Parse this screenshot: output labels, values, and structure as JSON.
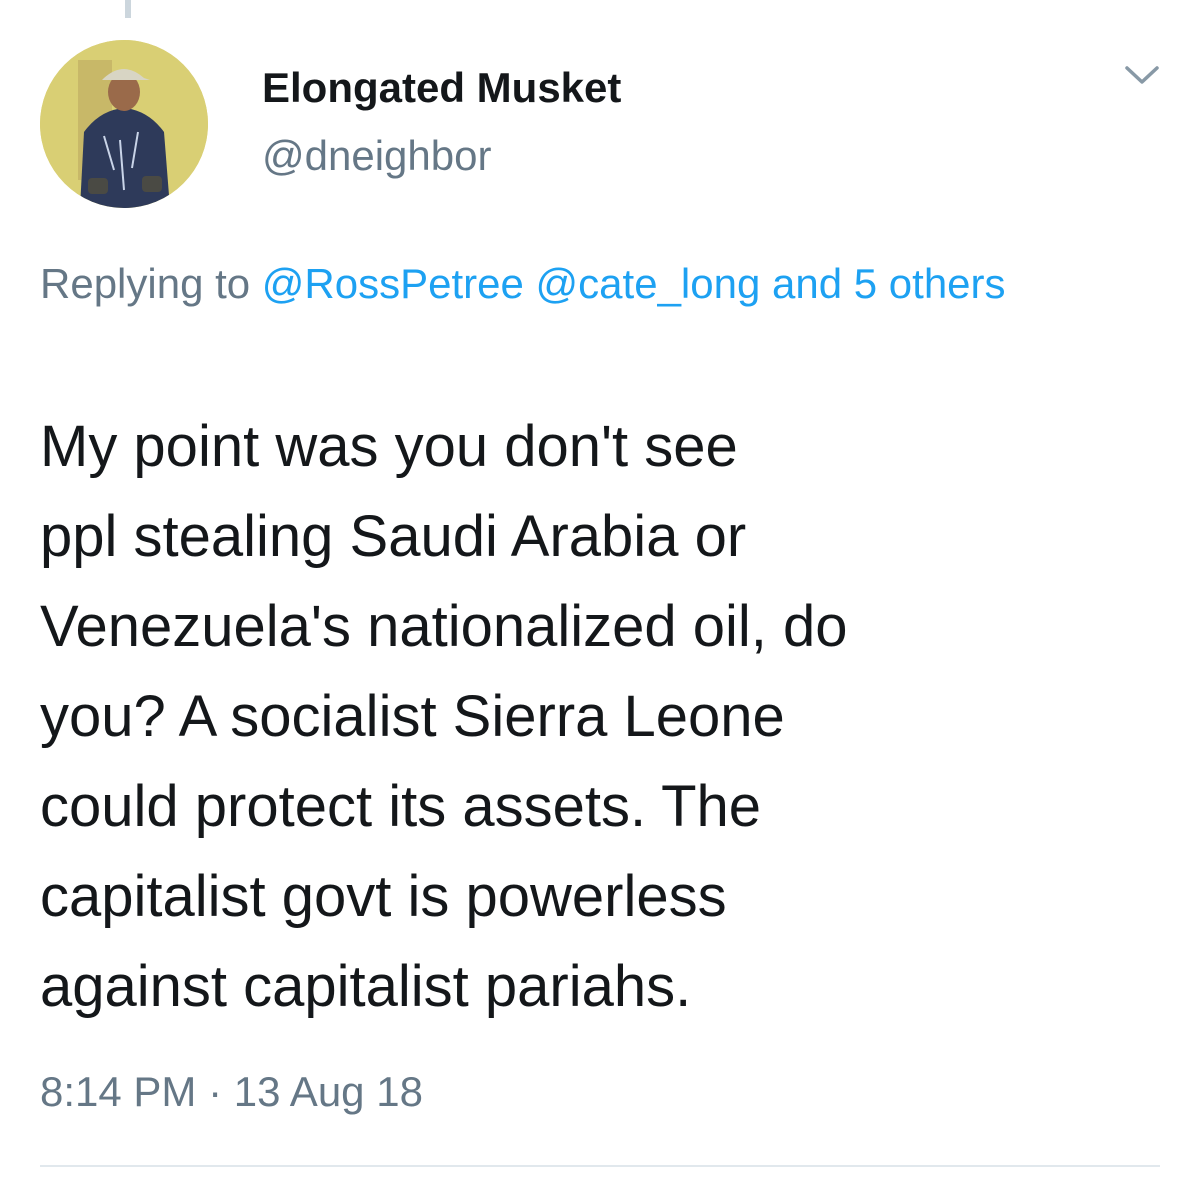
{
  "tweet": {
    "author": {
      "display_name": "Elongated Musket",
      "handle": "@dneighbor",
      "avatar_icon": "user-avatar-photo"
    },
    "menu_icon": "chevron-down-icon",
    "reply_context": {
      "prefix": "Replying to",
      "mention_1": "@RossPetree",
      "mention_2": "@cate_long",
      "more": "and 5 others"
    },
    "body_lines": [
      "My point was you don't see",
      "ppl stealing Saudi Arabia or",
      "Venezuela's nationalized oil, do",
      "you? A socialist Sierra Leone",
      "could protect its assets. The",
      "capitalist govt is powerless",
      "against capitalist pariahs."
    ],
    "timestamp": "8:14 PM · 13 Aug 18"
  },
  "colors": {
    "text": "#14171a",
    "muted": "#657786",
    "link": "#1da1f2",
    "divider": "#e1e8ed"
  }
}
